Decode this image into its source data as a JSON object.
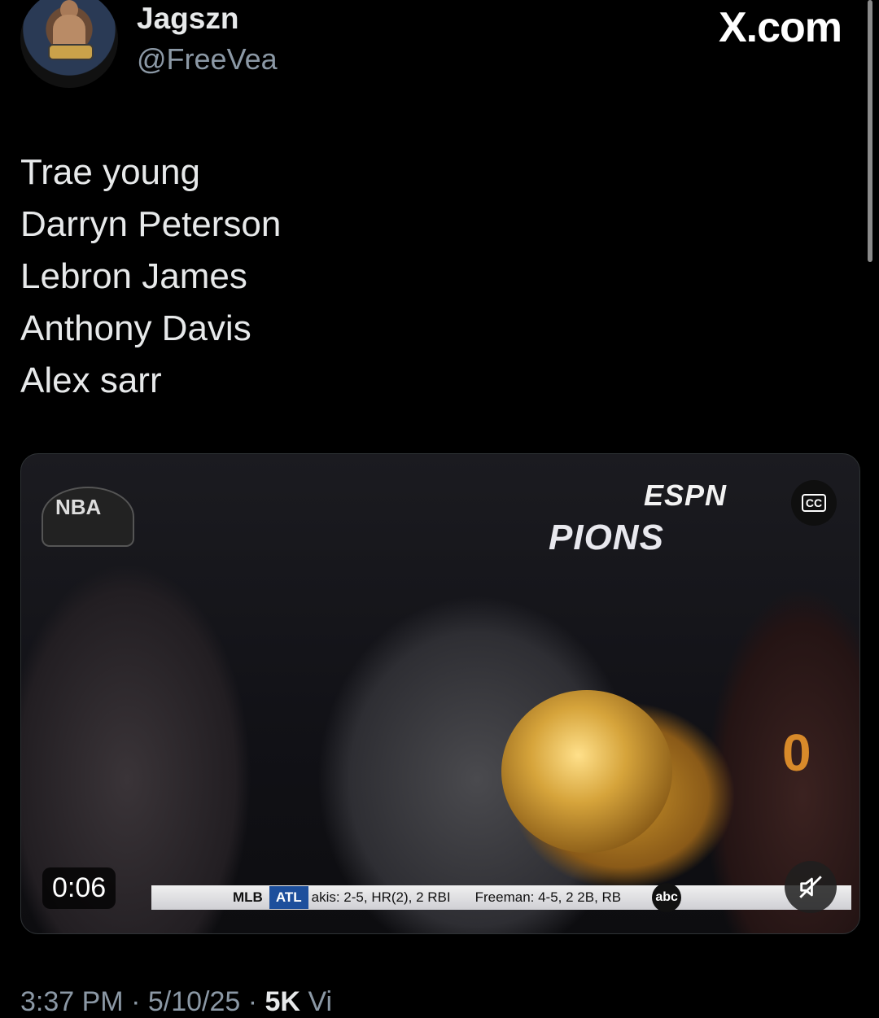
{
  "header": {
    "display_name": "Jagszn",
    "handle": "@FreeVea",
    "brand": "X.com",
    "avatar_icon": "user-avatar-with-belt"
  },
  "tweet": {
    "lines": [
      "Trae young",
      "Darryn Peterson",
      "Lebron James",
      "Anthony Davis",
      "Alex sarr"
    ]
  },
  "video": {
    "time": "0:06",
    "cc_label": "CC",
    "network_logo": "ESPN",
    "banner": "PIONS",
    "hat_label": "NBA",
    "jersey_number": "0",
    "ticker": {
      "league": "MLB",
      "team": "ATL",
      "stat1": "akis: 2-5, HR(2), 2 RBI",
      "stat2": "Freeman: 4-5, 2 2B, RB",
      "network": "abc"
    },
    "mute_icon": "muted-speaker-icon"
  },
  "meta": {
    "time": "3:37 PM",
    "date": "5/10/25",
    "views_count": "5K",
    "views_label": "Vi"
  },
  "colors": {
    "background": "#000000",
    "text": "#e7e9ea",
    "secondary_text": "#8b98a5"
  }
}
